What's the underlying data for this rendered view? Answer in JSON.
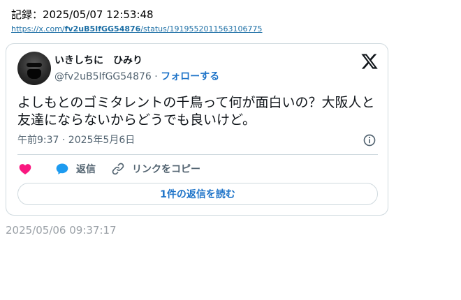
{
  "record": {
    "label": "記録：2025/05/07 12:53:48"
  },
  "url": {
    "prefix": "https://x.com/",
    "user": "fv2uB5IfGG54876",
    "suffix": "/status/1919552011563106775"
  },
  "tweet": {
    "display_name": "いきしちに　ひみり",
    "handle": "@fv2uB5IfGG54876",
    "separator": " · ",
    "follow_label": "フォローする",
    "text": "よしもとのゴミタレントの千鳥って何が面白いの？大阪人と友達にならないからどうでも良いけど。",
    "timestamp": "午前9:37 · 2025年5月6日",
    "actions": {
      "reply_label": "返信",
      "copy_link_label": "リンクをコピー"
    },
    "read_replies_label": "1件の返信を読む"
  },
  "footer": {
    "timestamp": "2025/05/06 09:37:17"
  },
  "colors": {
    "like": "#f91880",
    "reply": "#1d9bf0",
    "link": "#1d73c8",
    "muted": "#536471",
    "border": "#cfd9de"
  },
  "icons": [
    "x-logo-icon",
    "info-icon",
    "heart-icon",
    "speech-bubble-icon",
    "link-icon"
  ]
}
